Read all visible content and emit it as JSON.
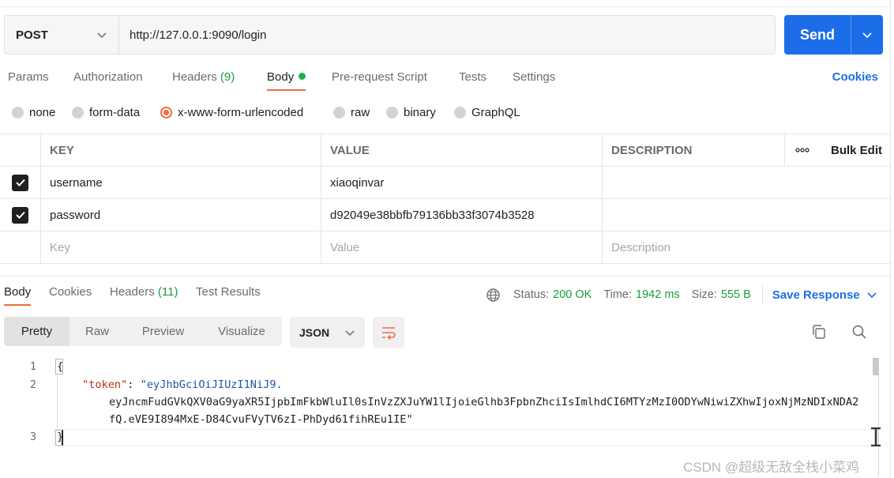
{
  "request": {
    "method": "POST",
    "url": "http://127.0.0.1:9090/login",
    "send_label": "Send"
  },
  "request_tabs": {
    "params": "Params",
    "authorization": "Authorization",
    "headers": "Headers",
    "headers_count": "(9)",
    "body": "Body",
    "prerequest": "Pre-request Script",
    "tests": "Tests",
    "settings": "Settings",
    "cookies": "Cookies"
  },
  "body_types": {
    "none": "none",
    "form_data": "form-data",
    "urlencoded": "x-www-form-urlencoded",
    "raw": "raw",
    "binary": "binary",
    "graphql": "GraphQL",
    "selected": "x-www-form-urlencoded"
  },
  "params_table": {
    "headers": {
      "key": "KEY",
      "value": "VALUE",
      "description": "DESCRIPTION",
      "bulk_edit": "Bulk Edit",
      "more": "ooo"
    },
    "rows": [
      {
        "key": "username",
        "value": "xiaoqinvar",
        "description": "",
        "checked": true
      },
      {
        "key": "password",
        "value": "d92049e38bbfb79136bb33f3074b3528",
        "description": "",
        "checked": true
      }
    ],
    "placeholders": {
      "key": "Key",
      "value": "Value",
      "description": "Description"
    }
  },
  "response_tabs": {
    "body": "Body",
    "cookies": "Cookies",
    "headers": "Headers",
    "headers_count": "(11)",
    "test_results": "Test Results"
  },
  "response_meta": {
    "status_label": "Status:",
    "status_value": "200 OK",
    "time_label": "Time:",
    "time_value": "1942 ms",
    "size_label": "Size:",
    "size_value": "555 B",
    "save_response": "Save Response"
  },
  "format_bar": {
    "pretty": "Pretty",
    "raw": "Raw",
    "preview": "Preview",
    "visualize": "Visualize",
    "language": "JSON"
  },
  "code": {
    "line_numbers": [
      "1",
      "2",
      "3"
    ],
    "open_brace": "{",
    "token_key": "\"token\"",
    "colon": ": ",
    "token_part1": "\"eyJhbGciOiJIUzI1NiJ9.",
    "token_part2": "eyJncmFudGVkQXV0aG9yaXR5IjpbImFkbWluIl0sInVzZXJuYW1lIjoieGlhb3FpbnZhciIsImlhdCI6MTYzMzI0ODYwNiwiZXhwIjoxNjMzNDIxNDA2",
    "token_part3": "fQ.eVE9I894MxE-D84CvuFVyTV6zI-PhDyd61fihREu1IE\"",
    "close_brace": "}"
  },
  "watermark": "CSDN @超级无敌全栈小菜鸡",
  "colors": {
    "accent_orange": "#f26b3a",
    "send_blue": "#1c6ee8",
    "success_green": "#1a9c3c",
    "json_key": "#b3351c",
    "json_string": "#1f56a6"
  }
}
